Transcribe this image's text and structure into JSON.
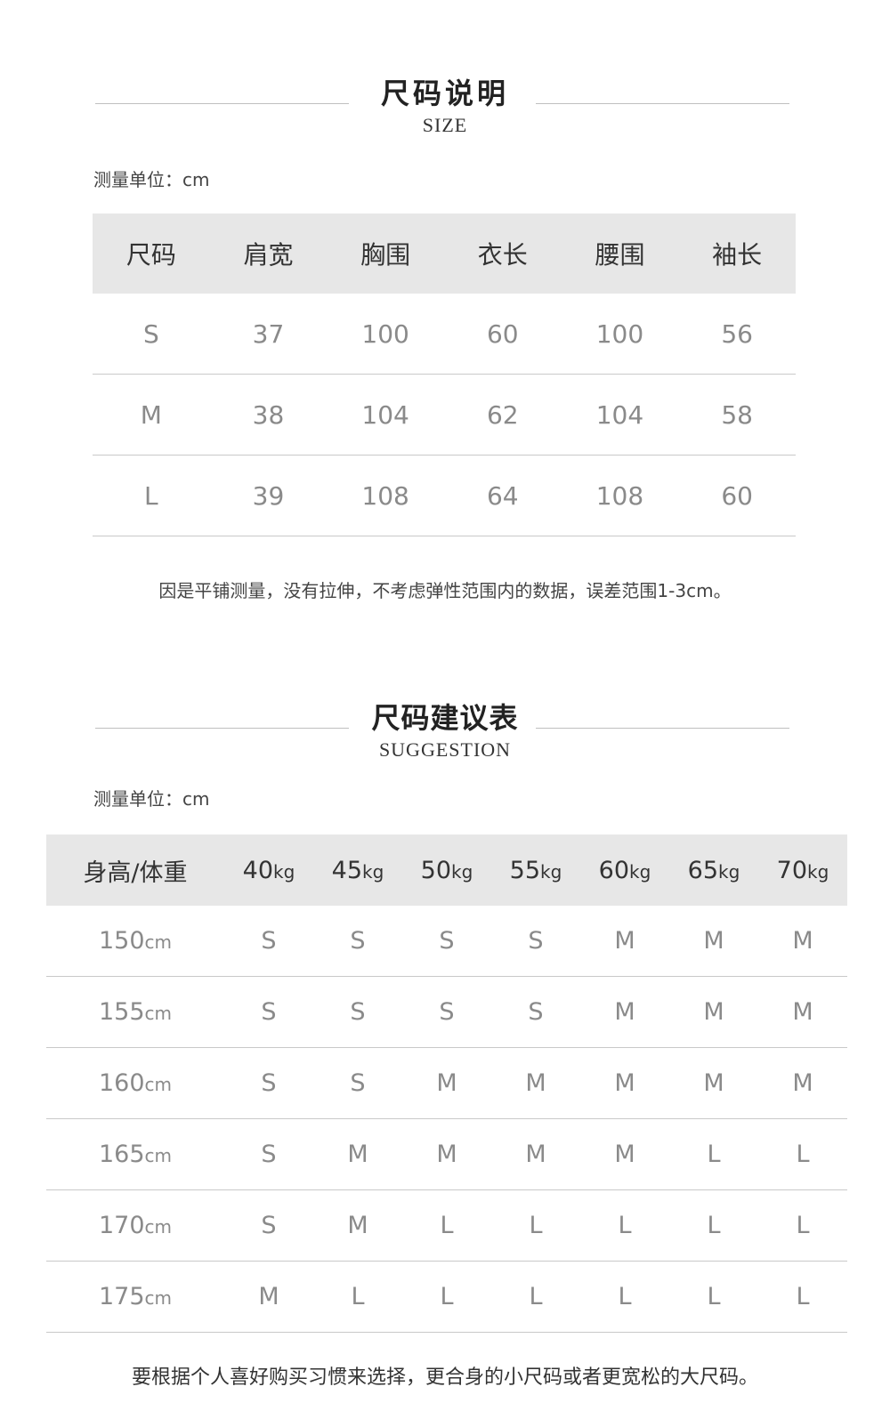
{
  "size_section": {
    "title": "尺码说明",
    "subtitle": "SIZE",
    "unit_note": "测量单位：cm",
    "headers": [
      "尺码",
      "肩宽",
      "胸围",
      "衣长",
      "腰围",
      "袖长"
    ],
    "rows": [
      [
        "S",
        "37",
        "100",
        "60",
        "100",
        "56"
      ],
      [
        "M",
        "38",
        "104",
        "62",
        "104",
        "58"
      ],
      [
        "L",
        "39",
        "108",
        "64",
        "108",
        "60"
      ]
    ],
    "footnote": "因是平铺测量，没有拉伸，不考虑弹性范围内的数据，误差范围1-3cm。"
  },
  "suggestion_section": {
    "title": "尺码建议表",
    "subtitle": "SUGGESTION",
    "unit_note": "测量单位：cm",
    "corner_header": "身高/体重",
    "weight_unit": "kg",
    "height_unit": "cm",
    "weights": [
      "40",
      "45",
      "50",
      "55",
      "60",
      "65",
      "70"
    ],
    "rows": [
      {
        "height": "150",
        "sizes": [
          "S",
          "S",
          "S",
          "S",
          "M",
          "M",
          "M"
        ]
      },
      {
        "height": "155",
        "sizes": [
          "S",
          "S",
          "S",
          "S",
          "M",
          "M",
          "M"
        ]
      },
      {
        "height": "160",
        "sizes": [
          "S",
          "S",
          "M",
          "M",
          "M",
          "M",
          "M"
        ]
      },
      {
        "height": "165",
        "sizes": [
          "S",
          "M",
          "M",
          "M",
          "M",
          "L",
          "L"
        ]
      },
      {
        "height": "170",
        "sizes": [
          "S",
          "M",
          "L",
          "L",
          "L",
          "L",
          "L"
        ]
      },
      {
        "height": "175",
        "sizes": [
          "M",
          "L",
          "L",
          "L",
          "L",
          "L",
          "L"
        ]
      }
    ],
    "footnote": "要根据个人喜好购买习惯来选择，更合身的小尺码或者更宽松的大尺码。"
  }
}
